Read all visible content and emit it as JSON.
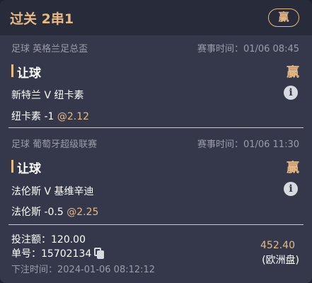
{
  "header": {
    "title": "过关 2串1",
    "result": "赢"
  },
  "legs": [
    {
      "league": "足球 英格兰足总盃",
      "match_time": "赛事时间：01/06 08:45",
      "bet_type": "让球",
      "result": "赢",
      "teams": "新特兰 V 纽卡素",
      "selection": "纽卡素 -1 ",
      "odds": "@2.12"
    },
    {
      "league": "足球 葡萄牙超级联赛",
      "match_time": "赛事时间：01/06 11:30",
      "bet_type": "让球",
      "result": "赢",
      "teams": "法伦斯 V 基维辛迪",
      "selection": "法伦斯 -0.5 ",
      "odds": "@2.25"
    }
  ],
  "footer": {
    "stake": "投注额：120.00",
    "order_no": "单号：15702134",
    "bet_time": "下注时间：2024-01-06 08:12:12",
    "payout": "452.40",
    "odds_type": "(欧洲盘)"
  },
  "colors": {
    "accent": "#e7b985",
    "card_bg": "#34384a",
    "header_bg": "#282b3a"
  },
  "icons": {
    "info": "info-icon",
    "copy": "copy-icon"
  }
}
